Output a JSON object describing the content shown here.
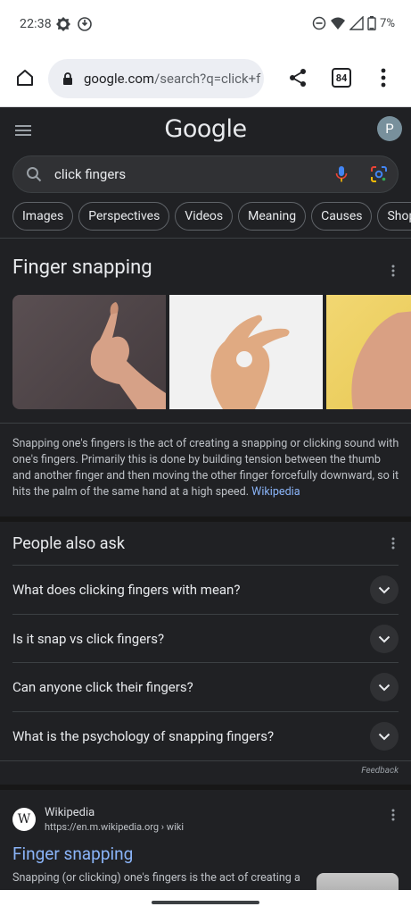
{
  "status_bar": {
    "time": "22:38",
    "battery_text": "7%",
    "icons": [
      "brightness-icon",
      "sync-icon",
      "dnd-icon",
      "wifi-icon",
      "signal-icon",
      "battery-icon"
    ]
  },
  "browser": {
    "url_host": "google.com",
    "url_path": "/search?q=click+f",
    "tab_count": "84"
  },
  "header": {
    "logo_text": "Google",
    "avatar_letter": "P"
  },
  "search": {
    "query": "click fingers"
  },
  "chips": [
    "Images",
    "Perspectives",
    "Videos",
    "Meaning",
    "Causes",
    "Shopping"
  ],
  "knowledge_panel": {
    "title": "Finger snapping",
    "description": "Snapping one's fingers is the act of creating a snapping or clicking sound with one's fingers. Primarily this is done by building tension between the thumb and another finger and then moving the other finger forcefully downward, so it hits the palm of the same hand at a high speed.",
    "source_link": "Wikipedia"
  },
  "people_also_ask": {
    "title": "People also ask",
    "questions": [
      "What does clicking fingers with mean?",
      "Is it snap vs click fingers?",
      "Can anyone click their fingers?",
      "What is the psychology of snapping fingers?"
    ],
    "feedback": "Feedback"
  },
  "result": {
    "logo_letter": "W",
    "site_name": "Wikipedia",
    "url": "https://en.m.wikipedia.org › wiki",
    "title": "Finger snapping",
    "snippet": "Snapping (or clicking) one's fingers is the act of creating a"
  },
  "colors": {
    "page_bg": "#202124",
    "link": "#8ab4f8",
    "text": "#e8eaed",
    "secondary_text": "#bdc1c6"
  }
}
